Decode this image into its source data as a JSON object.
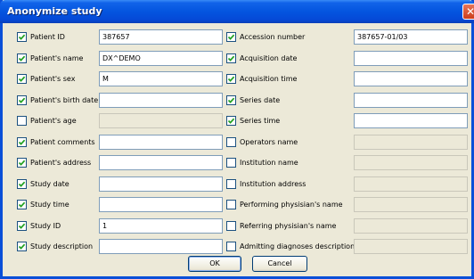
{
  "window": {
    "title": "Anonymize study",
    "close_glyph": "✕"
  },
  "left_fields": [
    {
      "label": "Patient ID",
      "checked": true,
      "value": "387657",
      "enabled": true
    },
    {
      "label": "Patient's name",
      "checked": true,
      "value": "DX^DEMO",
      "enabled": true
    },
    {
      "label": "Patient's sex",
      "checked": true,
      "value": "M",
      "enabled": true
    },
    {
      "label": "Patient's birth date",
      "checked": true,
      "value": "",
      "enabled": true
    },
    {
      "label": "Patient's age",
      "checked": false,
      "value": "",
      "enabled": false
    },
    {
      "label": "Patient comments",
      "checked": true,
      "value": "",
      "enabled": true
    },
    {
      "label": "Patient's address",
      "checked": true,
      "value": "",
      "enabled": true
    },
    {
      "label": "Study date",
      "checked": true,
      "value": "",
      "enabled": true
    },
    {
      "label": "Study time",
      "checked": true,
      "value": "",
      "enabled": true
    },
    {
      "label": "Study ID",
      "checked": true,
      "value": "1",
      "enabled": true
    },
    {
      "label": "Study description",
      "checked": true,
      "value": "",
      "enabled": true
    }
  ],
  "right_fields": [
    {
      "label": "Accession number",
      "checked": true,
      "value": "387657-01/03",
      "enabled": true
    },
    {
      "label": "Acquisition date",
      "checked": true,
      "value": "",
      "enabled": true
    },
    {
      "label": "Acquisition time",
      "checked": true,
      "value": "",
      "enabled": true
    },
    {
      "label": "Series date",
      "checked": true,
      "value": "",
      "enabled": true
    },
    {
      "label": "Series time",
      "checked": true,
      "value": "",
      "enabled": true
    },
    {
      "label": "Operators name",
      "checked": false,
      "value": "",
      "enabled": false
    },
    {
      "label": "Institution name",
      "checked": false,
      "value": "",
      "enabled": false
    },
    {
      "label": "Institution address",
      "checked": false,
      "value": "",
      "enabled": false
    },
    {
      "label": "Performing physisian's name",
      "checked": false,
      "value": "",
      "enabled": false
    },
    {
      "label": "Referring physisian's name",
      "checked": false,
      "value": "",
      "enabled": false
    },
    {
      "label": "Admitting diagnoses description",
      "checked": false,
      "value": "",
      "enabled": false
    }
  ],
  "buttons": {
    "ok_label": "OK",
    "cancel_label": "Cancel"
  },
  "colors": {
    "title_bar": "#0455df",
    "dialog_bg": "#ece9d8",
    "checkmark": "#21a121"
  }
}
